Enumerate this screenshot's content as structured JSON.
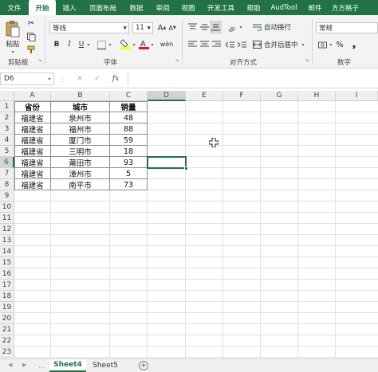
{
  "menu": {
    "tabs": [
      "文件",
      "开始",
      "插入",
      "页面布局",
      "数据",
      "审阅",
      "视图",
      "开发工具",
      "帮助",
      "AudTool",
      "邮件",
      "方方格子"
    ],
    "active_index": 1
  },
  "ribbon": {
    "clipboard": {
      "paste_label": "粘贴",
      "group_label": "剪贴板"
    },
    "font": {
      "font_name": "等线",
      "font_size": "11",
      "bold": "B",
      "italic": "I",
      "underline": "U",
      "grow": "A",
      "shrink": "A",
      "phonetic": "wén",
      "group_label": "字体"
    },
    "alignment": {
      "wrap_label": "自动换行",
      "merge_label": "合并后居中",
      "group_label": "对齐方式"
    },
    "number": {
      "format": "常规",
      "percent": "%",
      "group_label": "数字"
    },
    "colors": {
      "accent": "#217346",
      "font_red": "#e81123",
      "fill_yellow": "#ffff00"
    }
  },
  "formula_bar": {
    "name_box": "D6",
    "cancel": "✕",
    "confirm": "✓",
    "fx": "fx",
    "formula": ""
  },
  "grid": {
    "columns": [
      "A",
      "B",
      "C",
      "D",
      "E",
      "F",
      "G",
      "H",
      "I"
    ],
    "rows": [
      "1",
      "2",
      "3",
      "4",
      "5",
      "6",
      "7",
      "8",
      "9",
      "10",
      "11",
      "12",
      "13",
      "14",
      "15",
      "16",
      "17",
      "18",
      "19",
      "20",
      "21",
      "22",
      "23"
    ],
    "selected_cell": "D6",
    "headers": [
      "省份",
      "城市",
      "销量"
    ],
    "data": [
      [
        "福建省",
        "泉州市",
        "48"
      ],
      [
        "福建省",
        "福州市",
        "88"
      ],
      [
        "福建省",
        "厦门市",
        "59"
      ],
      [
        "福建省",
        "三明市",
        "18"
      ],
      [
        "福建省",
        "莆田市",
        "93"
      ],
      [
        "福建省",
        "漳州市",
        "5"
      ],
      [
        "福建省",
        "南平市",
        "73"
      ]
    ]
  },
  "sheets": {
    "tabs": [
      "Sheet4",
      "Sheet5"
    ],
    "active_index": 0,
    "add_label": "+"
  }
}
